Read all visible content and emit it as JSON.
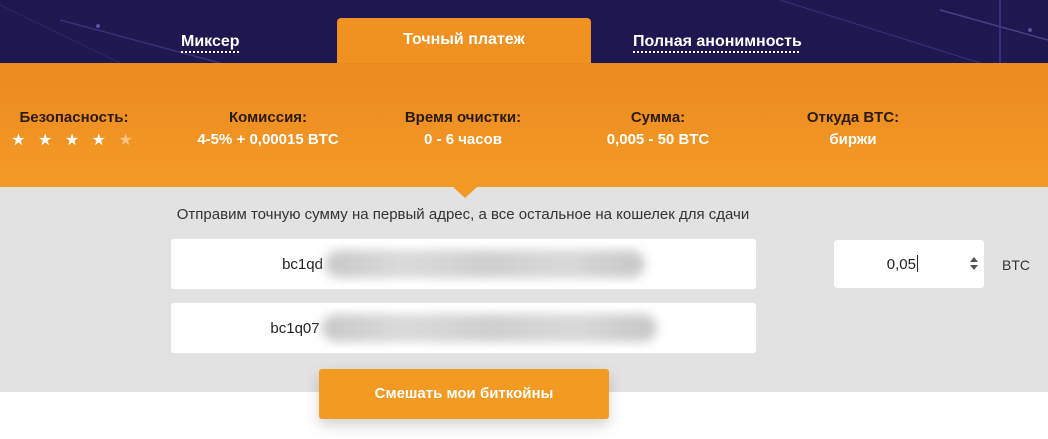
{
  "tabs": [
    {
      "label": "Миксер",
      "active": false
    },
    {
      "label": "Точный платеж",
      "active": true
    },
    {
      "label": "Полная анонимность",
      "active": false
    }
  ],
  "info": {
    "security": {
      "label": "Безопасность:",
      "rating": 4,
      "max": 5,
      "stars_on": "★ ★ ★ ★",
      "star_off": "★"
    },
    "commission": {
      "label": "Комиссия:",
      "value": "4-5% + 0,00015 BTC"
    },
    "clean_time": {
      "label": "Время очистки:",
      "value": "0 - 6 часов"
    },
    "amount": {
      "label": "Сумма:",
      "value": "0,005 - 50 BTC"
    },
    "source": {
      "label": "Откуда BTC:",
      "value": "биржи"
    }
  },
  "form": {
    "title": "Отправим точную сумму на первый адрес, а все остальное на кошелек для сдачи",
    "address_1_prefix": "bc1qd",
    "address_2_prefix": "bc1q07",
    "amount_value": "0,05",
    "unit": "BTC"
  },
  "action": {
    "mix_label": "Смешать мои биткойны"
  },
  "colors": {
    "header_bg": "#1f1750",
    "accent": "#f39a23",
    "form_bg": "#e2e2e2"
  }
}
